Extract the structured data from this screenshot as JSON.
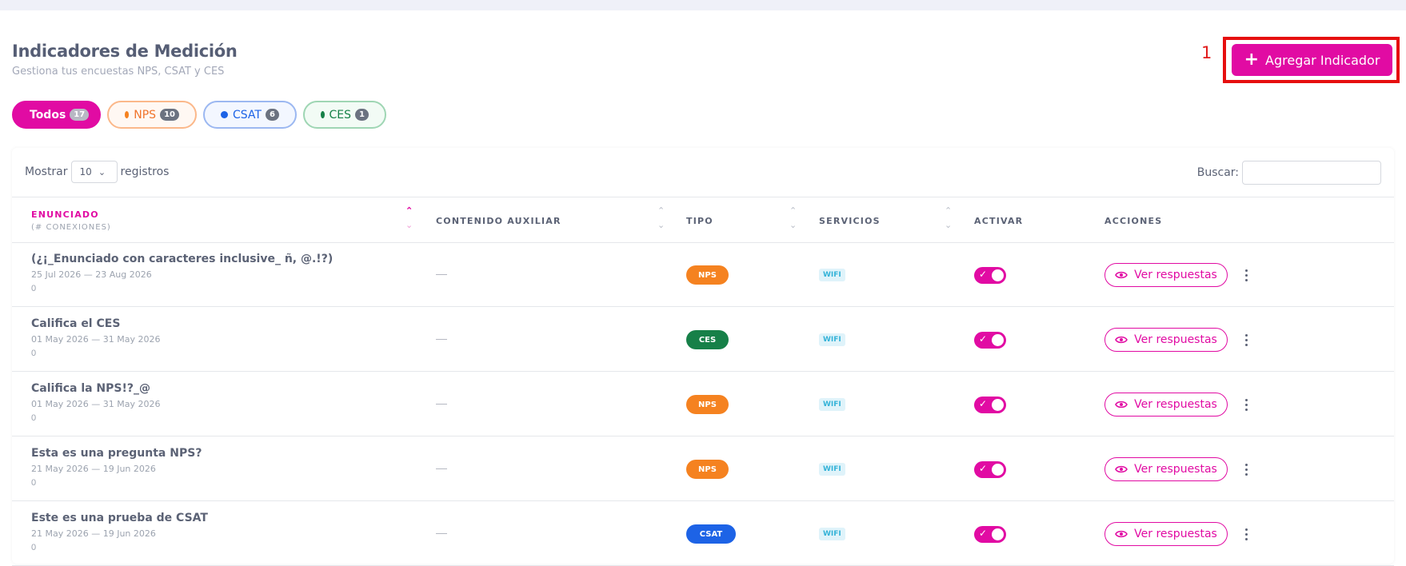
{
  "page": {
    "title": "Indicadores de Medición",
    "subtitle": "Gestiona tus encuestas NPS, CSAT y CES",
    "annotation_number": "1",
    "add_button_label": "Agregar Indicador"
  },
  "filters": [
    {
      "label": "Todos",
      "count": "17"
    },
    {
      "label": "NPS",
      "count": "10"
    },
    {
      "label": "CSAT",
      "count": "6"
    },
    {
      "label": "CES",
      "count": "1"
    }
  ],
  "table_controls": {
    "show_label": "Mostrar",
    "page_size": "10",
    "records_label": "registros",
    "search_label": "Buscar:"
  },
  "columns": {
    "enunciado": "ENUNCIADO",
    "enunciado_sub": "(# CONEXIONES)",
    "contenido": "CONTENIDO AUXILIAR",
    "tipo": "TIPO",
    "servicios": "SERVICIOS",
    "activar": "ACTIVAR",
    "acciones": "ACCIONES"
  },
  "rows": [
    {
      "title": "(¿¡_Enunciado con caracteres inclusive_ ñ, @.!?)",
      "dates": "25 Jul 2026 — 23 Aug 2026",
      "connections": "0",
      "aux": "—",
      "type": "NPS",
      "service": "WIFI",
      "action": "Ver respuestas"
    },
    {
      "title": "Califica el CES",
      "dates": "01 May 2026 — 31 May 2026",
      "connections": "0",
      "aux": "—",
      "type": "CES",
      "service": "WIFI",
      "action": "Ver respuestas"
    },
    {
      "title": "Califica la NPS!?_@",
      "dates": "01 May 2026 — 31 May 2026",
      "connections": "0",
      "aux": "—",
      "type": "NPS",
      "service": "WIFI",
      "action": "Ver respuestas"
    },
    {
      "title": "Esta es una pregunta NPS?",
      "dates": "21 May 2026 — 19 Jun 2026",
      "connections": "0",
      "aux": "—",
      "type": "NPS",
      "service": "WIFI",
      "action": "Ver respuestas"
    },
    {
      "title": "Este es una prueba de CSAT",
      "dates": "21 May 2026 — 19 Jun 2026",
      "connections": "0",
      "aux": "—",
      "type": "CSAT",
      "service": "WIFI",
      "action": "Ver respuestas"
    }
  ],
  "colors": {
    "accent": "#e10ba3",
    "nps": "#f58220",
    "csat": "#1d63e6",
    "ces": "#178048"
  }
}
